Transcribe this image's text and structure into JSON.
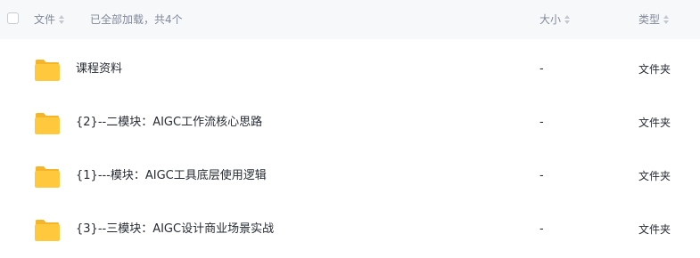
{
  "header": {
    "name_label": "文件",
    "loaded_status": "已全部加载，共4个",
    "size_label": "大小",
    "type_label": "类型"
  },
  "colors": {
    "folder": "#ffc83d",
    "folder_tab": "#f5b52a",
    "header_bg": "#f7f8fa",
    "muted_text": "#818999",
    "text": "#262b33"
  },
  "files": [
    {
      "icon": "folder-icon",
      "name": "课程资料",
      "size": "-",
      "type": "文件夹"
    },
    {
      "icon": "folder-icon",
      "name": "{2}--二模块：AIGC工作流核心思路",
      "size": "-",
      "type": "文件夹"
    },
    {
      "icon": "folder-icon",
      "name": "{1}---模块：AIGC工具底层使用逻辑",
      "size": "-",
      "type": "文件夹"
    },
    {
      "icon": "folder-icon",
      "name": "{3}--三模块：AIGC设计商业场景实战",
      "size": "-",
      "type": "文件夹"
    }
  ]
}
